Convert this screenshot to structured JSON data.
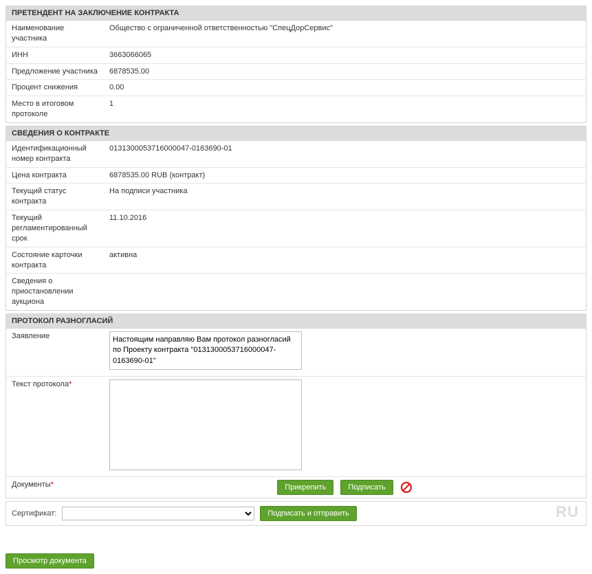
{
  "pretender": {
    "header": "ПРЕТЕНДЕНТ НА ЗАКЛЮЧЕНИЕ КОНТРАКТА",
    "name_label": "Наименование участника",
    "name_value": "Общество с ограниченной ответственностью \"СпецДорСервис\"",
    "inn_label": "ИНН",
    "inn_value": "3663066065",
    "offer_label": "Предложение участника",
    "offer_value": "6878535.00",
    "discount_label": "Процент снижения",
    "discount_value": "0.00",
    "place_label": "Место в итоговом протоколе",
    "place_value": "1"
  },
  "contract": {
    "header": "СВЕДЕНИЯ О КОНТРАКТЕ",
    "id_label": "Идентификационный номер контракта",
    "id_value": "0131300053716000047-0163690-01",
    "price_label": "Цена контракта",
    "price_value": "6878535.00  RUB  (контракт)",
    "status_label": "Текущий статус контракта",
    "status_value": "На подписи участника",
    "deadline_label": "Текущий регламентированный срок",
    "deadline_value": "11.10.2016",
    "card_label": "Состояние карточки контракта",
    "card_value": "активна",
    "suspend_label": "Сведения о приостановлении аукциона",
    "suspend_value": ""
  },
  "protocol": {
    "header": "ПРОТОКОЛ РАЗНОГЛАСИЙ",
    "statement_label": "Заявление",
    "statement_value": "Настоящим направляю Вам протокол разногласий по Проекту контракта \"0131300053716000047-0163690-01\"",
    "text_label": "Текст протокола",
    "text_value": "",
    "documents_label": "Документы",
    "attach_btn": "Прикрепить",
    "sign_btn": "Подписать"
  },
  "signing": {
    "cert_label": "Сертификат:",
    "sign_send_btn": "Подписать и отправить",
    "watermark": "RU"
  },
  "footer": {
    "preview_btn": "Просмотр документа"
  }
}
